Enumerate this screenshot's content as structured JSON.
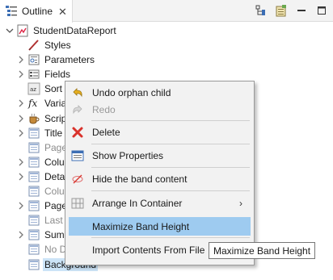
{
  "tab": {
    "title": "Outline",
    "close_glyph": "✕"
  },
  "tree": {
    "root": {
      "label": "StudentDataReport",
      "icon": "report-icon"
    },
    "items": [
      {
        "label": "Styles",
        "icon": "pen-icon",
        "expandable": false,
        "dim": false
      },
      {
        "label": "Parameters",
        "icon": "parameters-icon",
        "expandable": true,
        "dim": false
      },
      {
        "label": "Fields",
        "icon": "fields-icon",
        "expandable": true,
        "dim": false
      },
      {
        "label": "Sort F",
        "icon": "sort-icon",
        "expandable": false,
        "dim": false
      },
      {
        "label": "Varia",
        "icon": "fx-icon",
        "expandable": true,
        "dim": false
      },
      {
        "label": "Scrip",
        "icon": "script-icon",
        "expandable": true,
        "dim": false
      },
      {
        "label": "Title",
        "icon": "band-icon",
        "expandable": true,
        "dim": false
      },
      {
        "label": "Page",
        "icon": "band-icon",
        "expandable": false,
        "dim": true
      },
      {
        "label": "Colu",
        "icon": "band-icon",
        "expandable": true,
        "dim": false
      },
      {
        "label": "Detai",
        "icon": "band-icon",
        "expandable": true,
        "dim": false
      },
      {
        "label": "Colu",
        "icon": "band-icon",
        "expandable": false,
        "dim": true
      },
      {
        "label": "Page",
        "icon": "band-icon",
        "expandable": true,
        "dim": false
      },
      {
        "label": "Last I",
        "icon": "band-icon",
        "expandable": false,
        "dim": true
      },
      {
        "label": "Sumi",
        "icon": "band-icon",
        "expandable": true,
        "dim": false
      },
      {
        "label": "No D",
        "icon": "band-icon",
        "expandable": false,
        "dim": true
      },
      {
        "label": "Background",
        "icon": "band-icon",
        "expandable": false,
        "dim": false,
        "selected": true
      }
    ]
  },
  "menu": {
    "items": [
      {
        "label": "Undo orphan child",
        "icon": "undo-icon",
        "disabled": false
      },
      {
        "label": "Redo",
        "icon": "redo-icon",
        "disabled": true
      },
      {
        "label": "Delete",
        "icon": "delete-icon",
        "disabled": false
      },
      {
        "label": "Show Properties",
        "icon": "properties-icon",
        "disabled": false
      },
      {
        "label": "Hide the band content",
        "icon": "hide-icon",
        "disabled": false
      },
      {
        "label": "Arrange In Container",
        "icon": "grid-icon",
        "disabled": false,
        "submenu": true,
        "submenu_glyph": "›"
      },
      {
        "label": "Maximize Band Height",
        "icon": "",
        "disabled": false,
        "highlighted": true
      },
      {
        "label": "Import Contents From File",
        "icon": "",
        "disabled": false
      }
    ]
  },
  "tooltip": {
    "text": "Maximize Band Height"
  },
  "colors": {
    "highlight": "#9ecbf0",
    "selection": "#cce4f7",
    "delete_red": "#d9322b"
  }
}
